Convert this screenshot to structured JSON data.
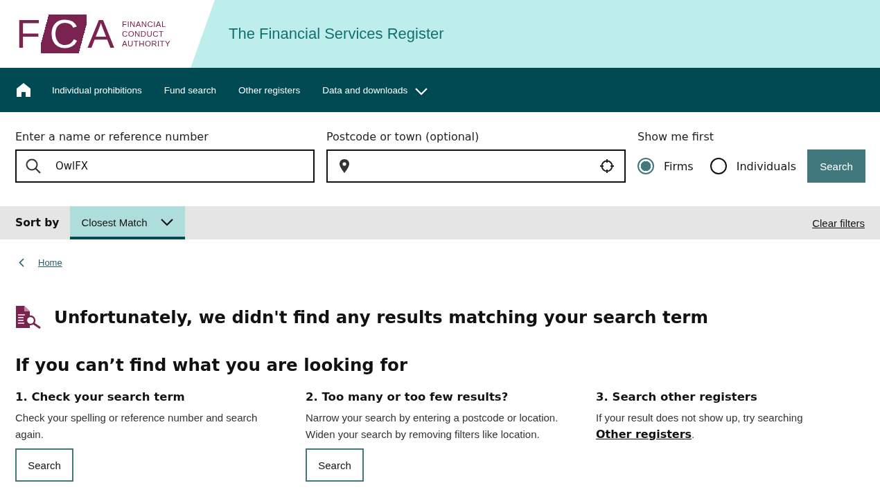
{
  "header": {
    "logo_letters": "FCA",
    "logo_words": [
      "FINANCIAL",
      "CONDUCT",
      "AUTHORITY"
    ],
    "title": "The Financial Services Register"
  },
  "nav": {
    "items": [
      {
        "label": "Individual prohibitions",
        "kind": "link"
      },
      {
        "label": "Fund search",
        "kind": "link"
      },
      {
        "label": "Other registers",
        "kind": "link"
      },
      {
        "label": "Data and downloads",
        "kind": "dropdown"
      }
    ]
  },
  "search": {
    "name_label": "Enter a name or reference number",
    "name_value": "OwlFX",
    "location_label": "Postcode or town (optional)",
    "show_label": "Show me first",
    "options": [
      {
        "label": "Firms",
        "selected": true
      },
      {
        "label": "Individuals",
        "selected": false
      }
    ],
    "button": "Search"
  },
  "sort": {
    "label": "Sort by",
    "value": "Closest Match",
    "clear": "Clear filters"
  },
  "breadcrumb": "Home",
  "no_results": "Unfortunately, we didn't find any results matching your search term",
  "help": {
    "title": "If you can’t find what you are looking for",
    "columns": [
      {
        "heading": "1. Check your search term",
        "text": "Check your spelling or reference number and search again.",
        "button": "Search"
      },
      {
        "heading": "2. Too many or too few results?",
        "lines": [
          "Narrow your search by entering a postcode or location.",
          "Widen your search by removing filters like location."
        ],
        "button": "Search"
      },
      {
        "heading": "3. Search other registers",
        "text": "If your result does not show up, try searching",
        "link": "Other registers",
        "after": "."
      }
    ]
  }
}
